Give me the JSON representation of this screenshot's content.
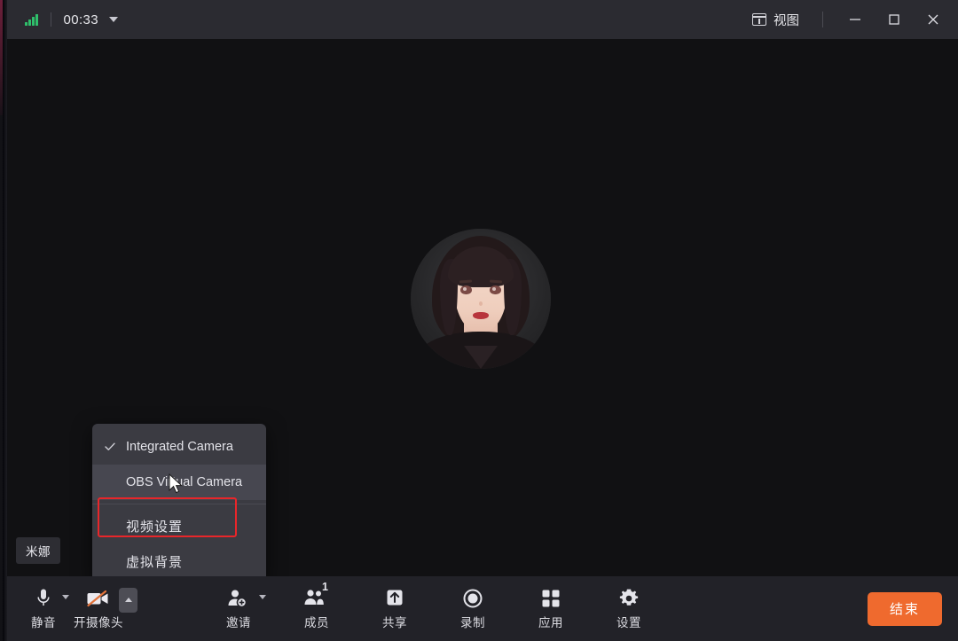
{
  "titlebar": {
    "signal_icon": "signal-bars-icon",
    "timer": "00:33",
    "timer_caret_icon": "chevron-down-icon",
    "view_label": "视图",
    "view_icon": "layout-grid-icon",
    "minimize_icon": "minimize-icon",
    "maximize_icon": "maximize-icon",
    "close_icon": "close-icon"
  },
  "stage": {
    "participant_name": "米娜",
    "avatar_alt": "avatar-portrait"
  },
  "camera_menu": {
    "items": [
      {
        "label": "Integrated Camera",
        "checked": true,
        "hovered": false,
        "highlighted": false
      },
      {
        "label": "OBS Virtual Camera",
        "checked": false,
        "hovered": true,
        "highlighted": false
      },
      {
        "label": "视频设置",
        "checked": false,
        "hovered": false,
        "highlighted": true
      },
      {
        "label": "虚拟背景",
        "checked": false,
        "hovered": false,
        "highlighted": false
      }
    ],
    "highlight_color": "#e8262a",
    "check_icon": "check-icon"
  },
  "toolbar": {
    "mute": {
      "label": "静音",
      "icon": "microphone-icon",
      "caret_icon": "chevron-down-icon"
    },
    "camera": {
      "label": "开摄像头",
      "icon": "camera-off-icon",
      "caret_icon": "chevron-up-icon",
      "slash_color": "#e2723a"
    },
    "invite": {
      "label": "邀请",
      "icon": "person-add-icon",
      "caret_icon": "chevron-down-icon"
    },
    "members": {
      "label": "成员",
      "icon": "people-icon",
      "count": "1"
    },
    "share": {
      "label": "共享",
      "icon": "share-up-arrow-icon"
    },
    "record": {
      "label": "录制",
      "icon": "record-circle-icon"
    },
    "apps": {
      "label": "应用",
      "icon": "grid-apps-icon"
    },
    "settings": {
      "label": "设置",
      "icon": "gear-icon"
    },
    "end": {
      "label": "结束",
      "color": "#ef6a2e"
    }
  }
}
